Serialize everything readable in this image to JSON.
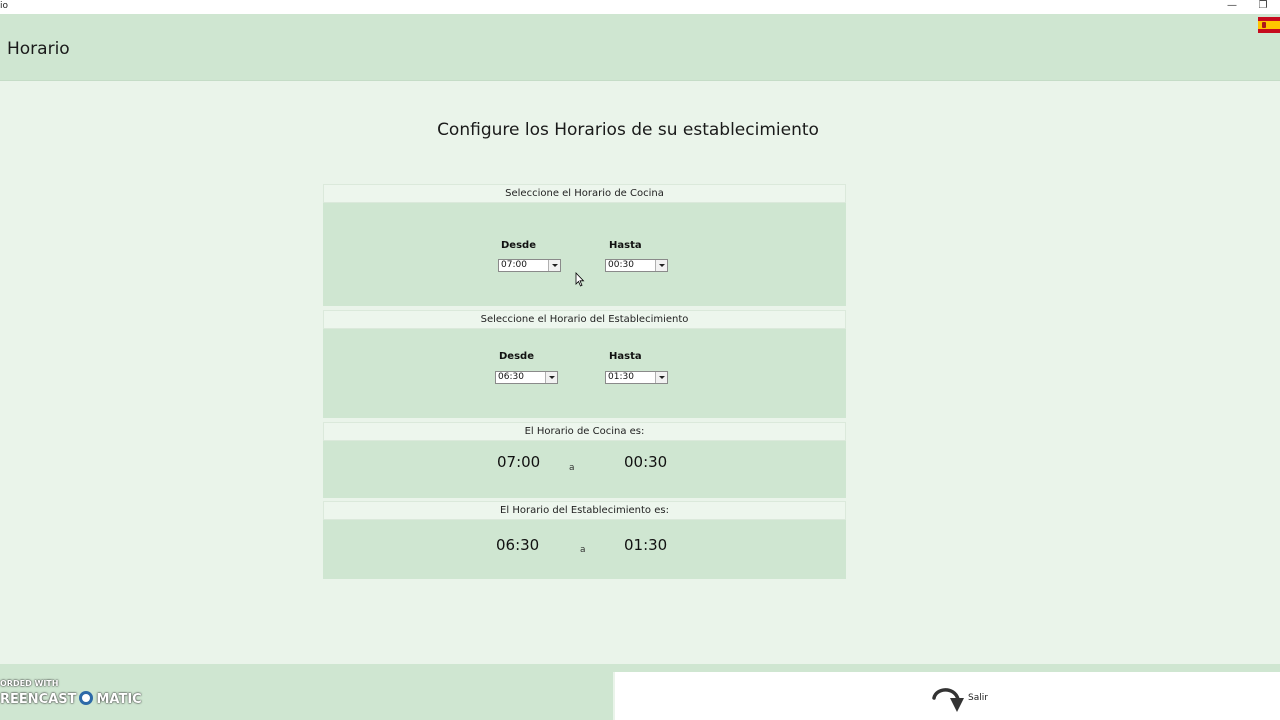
{
  "window": {
    "title": "io",
    "minimize": "—",
    "restore": "❐"
  },
  "header": {
    "title": "Horario",
    "flag_icon": "spain-flag-icon"
  },
  "page": {
    "subtitle": "Configure los Horarios de su establecimiento"
  },
  "cocina": {
    "heading": "Seleccione el Horario de Cocina",
    "desde_label": "Desde",
    "hasta_label": "Hasta",
    "desde_value": "07:00",
    "hasta_value": "00:30"
  },
  "establecimiento": {
    "heading": "Seleccione el Horario del Establecimiento",
    "desde_label": "Desde",
    "hasta_label": "Hasta",
    "desde_value": "06:30",
    "hasta_value": "01:30"
  },
  "summary_cocina": {
    "heading": "El Horario de Cocina es:",
    "from": "07:00",
    "sep": "a",
    "to": "00:30"
  },
  "summary_establecimiento": {
    "heading": "El Horario del Establecimiento es:",
    "from": "06:30",
    "sep": "a",
    "to": "01:30"
  },
  "footer": {
    "exit_label": "Salir",
    "exit_icon": "curved-arrow-icon"
  },
  "watermark": {
    "line1": "ORDED WITH",
    "line2a": "REENCAST",
    "line2b": "MATIC"
  },
  "colors": {
    "panel": "#cfe6d1",
    "background": "#eaf4ea",
    "header": "#cfe6d1"
  }
}
